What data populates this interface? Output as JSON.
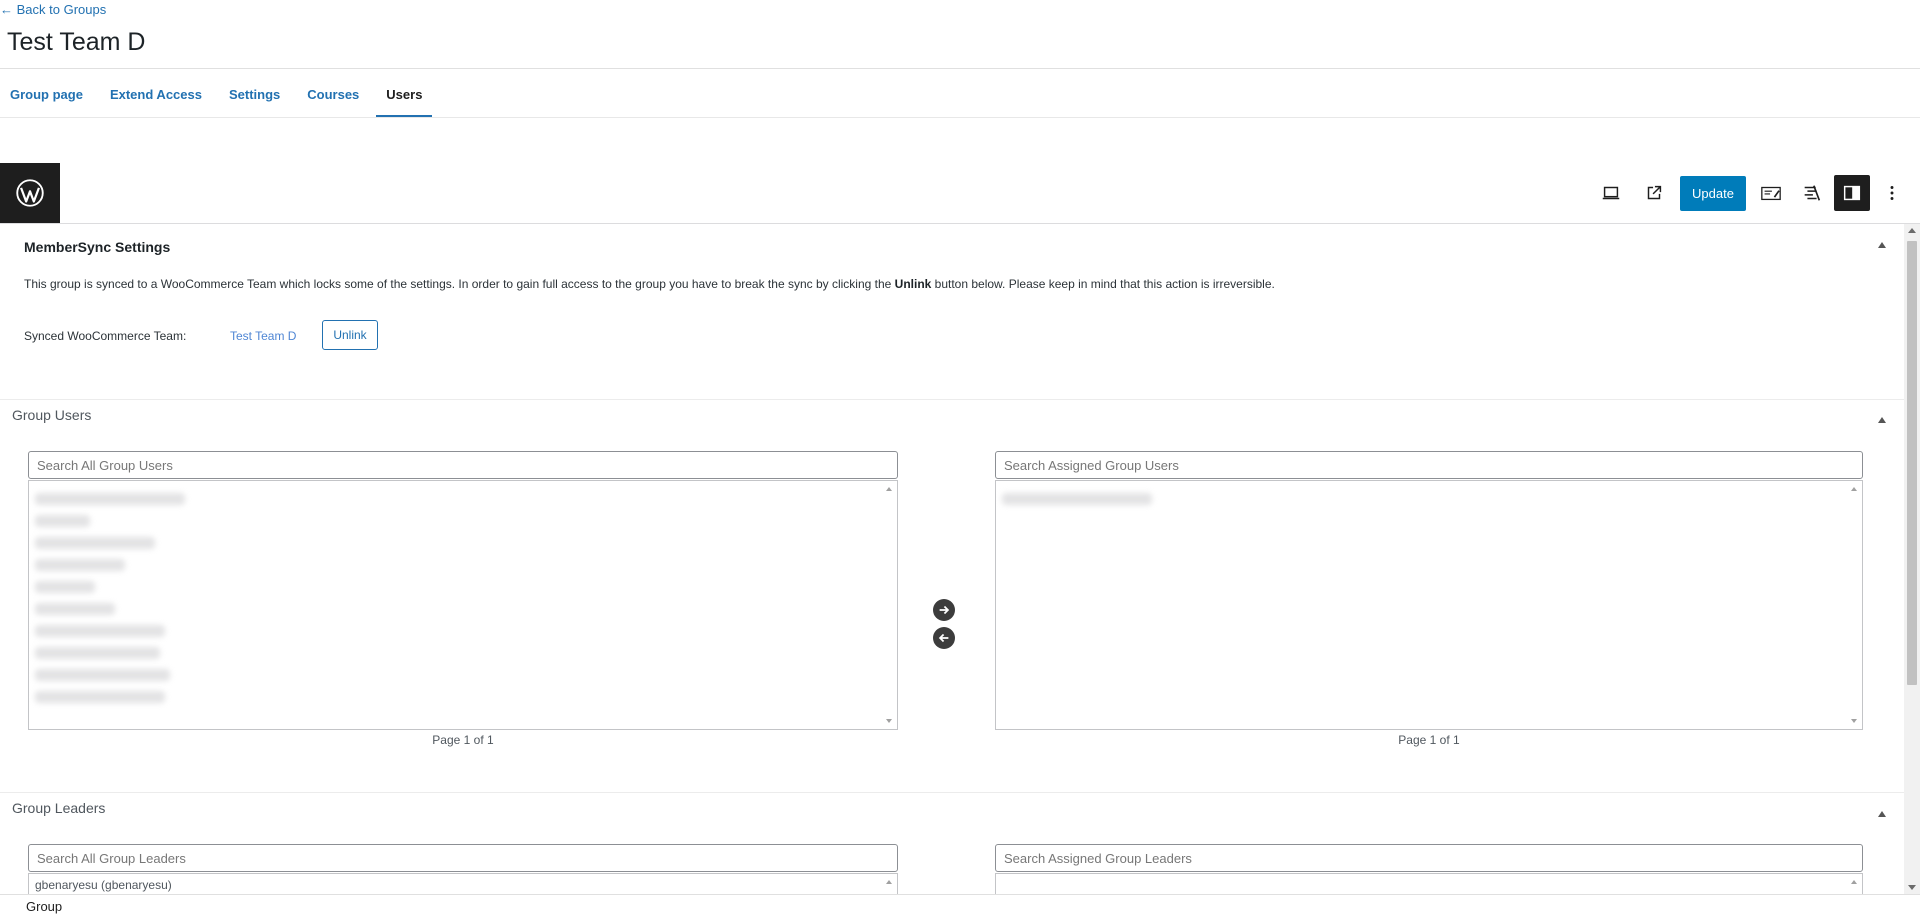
{
  "header": {
    "back_link": "← Back to Groups",
    "title": "Test Team D"
  },
  "tabs": [
    {
      "label": "Group page"
    },
    {
      "label": "Extend Access"
    },
    {
      "label": "Settings"
    },
    {
      "label": "Courses"
    },
    {
      "label": "Users"
    }
  ],
  "active_tab": "Users",
  "toolbar": {
    "update_label": "Update"
  },
  "membersync": {
    "title": "MemberSync Settings",
    "desc_before": "This group is synced to a WooCommerce Team which locks some of the settings. In order to gain full access to the group you have to break the sync by clicking the ",
    "desc_bold": "Unlink",
    "desc_after": " button below. Please keep in mind that this action is irreversible.",
    "synced_label": "Synced WooCommerce Team:",
    "team_name": "Test Team D",
    "unlink_label": "Unlink"
  },
  "group_users": {
    "title": "Group Users",
    "search_all_placeholder": "Search All Group Users",
    "search_assigned_placeholder": "Search Assigned Group Users",
    "pager_all": "Page 1 of 1",
    "pager_assigned": "Page 1 of 1"
  },
  "group_leaders": {
    "title": "Group Leaders",
    "search_all_placeholder": "Search All Group Leaders",
    "search_assigned_placeholder": "Search Assigned Group Leaders",
    "first_item": "gbenaryesu (gbenaryesu)"
  },
  "footer": {
    "breadcrumb": "Group"
  },
  "colors": {
    "accent": "#2271b1",
    "update_button": "#007cba",
    "dark": "#1e1e1e"
  }
}
